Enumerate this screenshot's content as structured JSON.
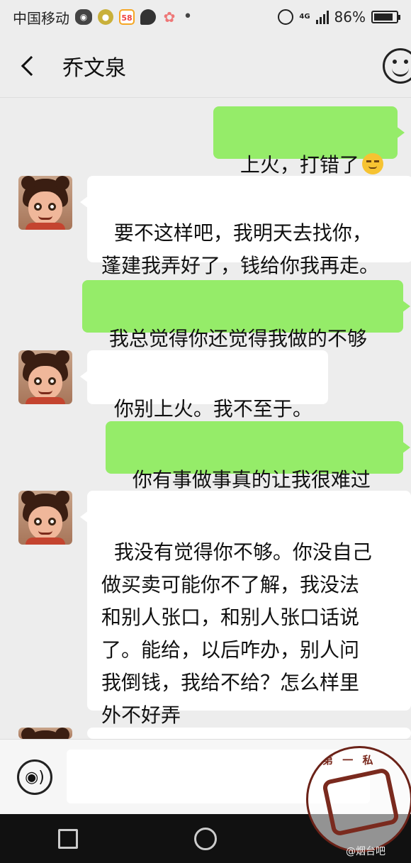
{
  "status_bar": {
    "carrier": "中国移动",
    "app_icons": [
      "wechat-icon",
      "coin-icon",
      "58-icon",
      "chat-bubble-icon",
      "paw-icon",
      "dot-icon"
    ],
    "badge_58": "58",
    "network": "4G",
    "battery": "86%",
    "battery_level": 0.86
  },
  "header": {
    "title": "乔文泉"
  },
  "messages": [
    {
      "side": "right",
      "text": "上火，打错了",
      "emoji": "smirk-emoji"
    },
    {
      "side": "left",
      "text": "要不这样吧，我明天去找你，\n蓬建我弄好了，钱给你我再走。"
    },
    {
      "side": "right",
      "text": "我总觉得你还觉得我做的不够"
    },
    {
      "side": "left",
      "text": "你别上火。我不至于。"
    },
    {
      "side": "right",
      "text": "你有事做事真的让我很难过"
    },
    {
      "side": "left",
      "text": "我没有觉得你不够。你没自己\n做买卖可能你不了解，我没法\n和别人张口，和别人张口话说\n了。能给，以后咋办，别人问\n我倒钱，我给不给？怎么样里\n外不好弄"
    }
  ],
  "input_bar": {
    "placeholder": "",
    "value": ""
  },
  "watermark": {
    "caption": "@烟台吧"
  },
  "colors": {
    "background": "#ededed",
    "bubble_sent": "#95ec69",
    "bubble_received": "#ffffff"
  }
}
